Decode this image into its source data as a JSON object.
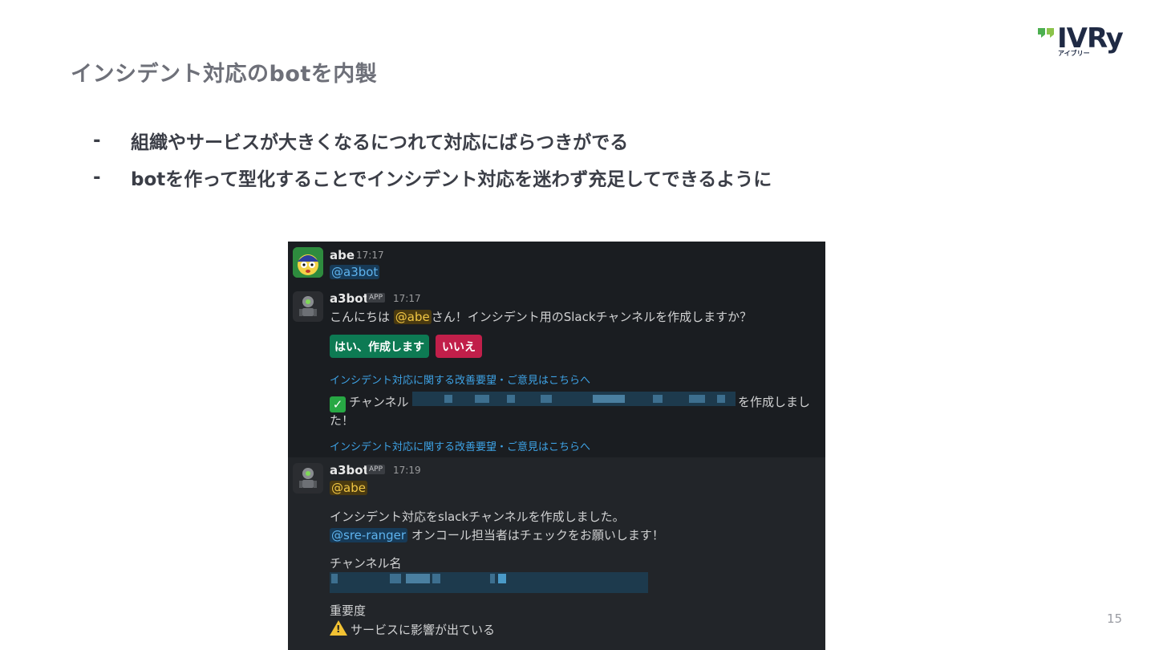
{
  "slide": {
    "title": "インシデント対応のbotを内製",
    "bullets": [
      "組織やサービスが大きくなるにつれて対応にばらつきがでる",
      "botを作って型化することでインシデント対応を迷わず充足してできるように"
    ],
    "bullet_marker": "-",
    "page_number": "15"
  },
  "logo": {
    "text": "IVRy",
    "sub": "アイブリー",
    "colors": {
      "mark": "#4caf50",
      "text": "#1f2a44"
    }
  },
  "slack": {
    "colors": {
      "background": "#1a1d21",
      "link": "#3ea3e6",
      "yes_button": "#0d7a53",
      "no_button": "#c11f4a"
    },
    "messages": [
      {
        "author": "abe",
        "time": "17:17",
        "text": "@a3bot"
      },
      {
        "author": "a3bot",
        "badge": "APP",
        "time": "17:17",
        "greeting_prefix": "こんにちは ",
        "mention": "@abe",
        "greeting_suffix": "さん！インシデント用のSlackチャンネルを作成しますか？",
        "buttons": {
          "yes": "はい、作成します",
          "no": "いいえ"
        },
        "feedback_link": "インシデント対応に関する改善要望・ご意見はこちらへ",
        "created_prefix": "チャンネル",
        "created_suffix": "を作成しまし",
        "created_wrap": "た！",
        "feedback_link_2": "インシデント対応に関する改善要望・ご意見はこちらへ"
      },
      {
        "author": "a3bot",
        "badge": "APP",
        "time": "17:19",
        "mention": "@abe",
        "line1": "インシデント対応をslackチャンネルを作成しました。",
        "group_mention": "@sre-ranger",
        "line2": " オンコール担当者はチェックをお願いします！",
        "channel_label": "チャンネル名",
        "severity_label": "重要度",
        "severity_value": "サービスに影響が出ている"
      }
    ]
  }
}
